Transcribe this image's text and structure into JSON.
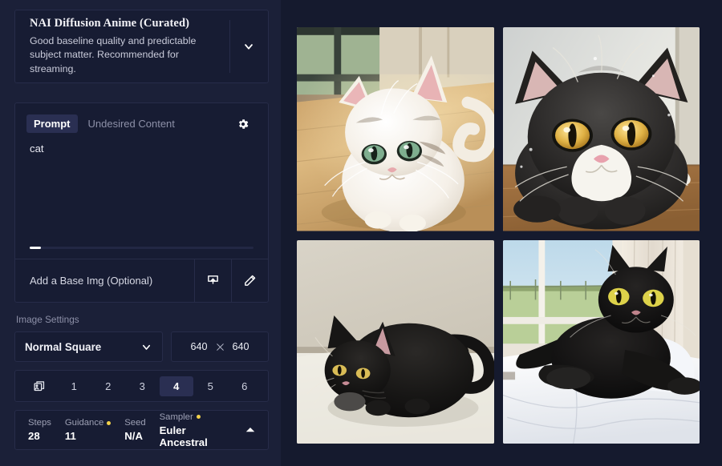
{
  "model": {
    "title": "NAI Diffusion Anime (Curated)",
    "description": "Good baseline quality and predictable subject matter. Recommended for streaming.",
    "chevron_icon": "chevron-down-icon"
  },
  "prompt": {
    "tabs": [
      {
        "label": "Prompt",
        "active": true
      },
      {
        "label": "Undesired Content",
        "active": false
      }
    ],
    "settings_icon": "gear-icon",
    "text": "cat",
    "token_fill_percent": 5,
    "base_image_label": "Add a Base Img (Optional)",
    "upload_icon": "upload-icon",
    "draw_icon": "pencil-icon"
  },
  "image_settings": {
    "section_label": "Image Settings",
    "aspect_preset": "Normal Square",
    "width": "640",
    "height": "640",
    "dimension_separator": "×"
  },
  "batch": {
    "icon": "stacked-images-icon",
    "options": [
      "1",
      "2",
      "3",
      "4",
      "5",
      "6"
    ],
    "selected": "4"
  },
  "params": [
    {
      "label": "Steps",
      "value": "28",
      "modified": false
    },
    {
      "label": "Guidance",
      "value": "11",
      "modified": true
    },
    {
      "label": "Seed",
      "value": "N/A",
      "modified": false
    },
    {
      "label": "Sampler",
      "value": "Euler Ancestral",
      "modified": true
    }
  ],
  "params_collapse_icon": "chevron-up-icon",
  "colors": {
    "app_background": "#10142a",
    "left_panel": "#1b2038",
    "right_panel": "#151a2e",
    "card": "#171c33",
    "border": "#272c49",
    "accent_selected": "#2a2f52",
    "modified_dot": "#f2d14b",
    "scrollbar": "#8a8c98"
  },
  "results": [
    {
      "name": "white-cream-cat-on-wooden-floor",
      "alt": "Cream white anime cat with green eyes sitting on a sunlit wooden floor by a window"
    },
    {
      "name": "tuxedo-cat-closeup-yellow-eyes",
      "alt": "Black tuxedo cat with yellow eyes and white muzzle lying on a wooden table"
    },
    {
      "name": "black-cat-crouching-on-floor",
      "alt": "Black cat crouching on a pale floor against a beige wall"
    },
    {
      "name": "black-cat-on-white-bed-by-window",
      "alt": "Black cat with yellow eyes resting on a white bed next to a bright window"
    }
  ]
}
